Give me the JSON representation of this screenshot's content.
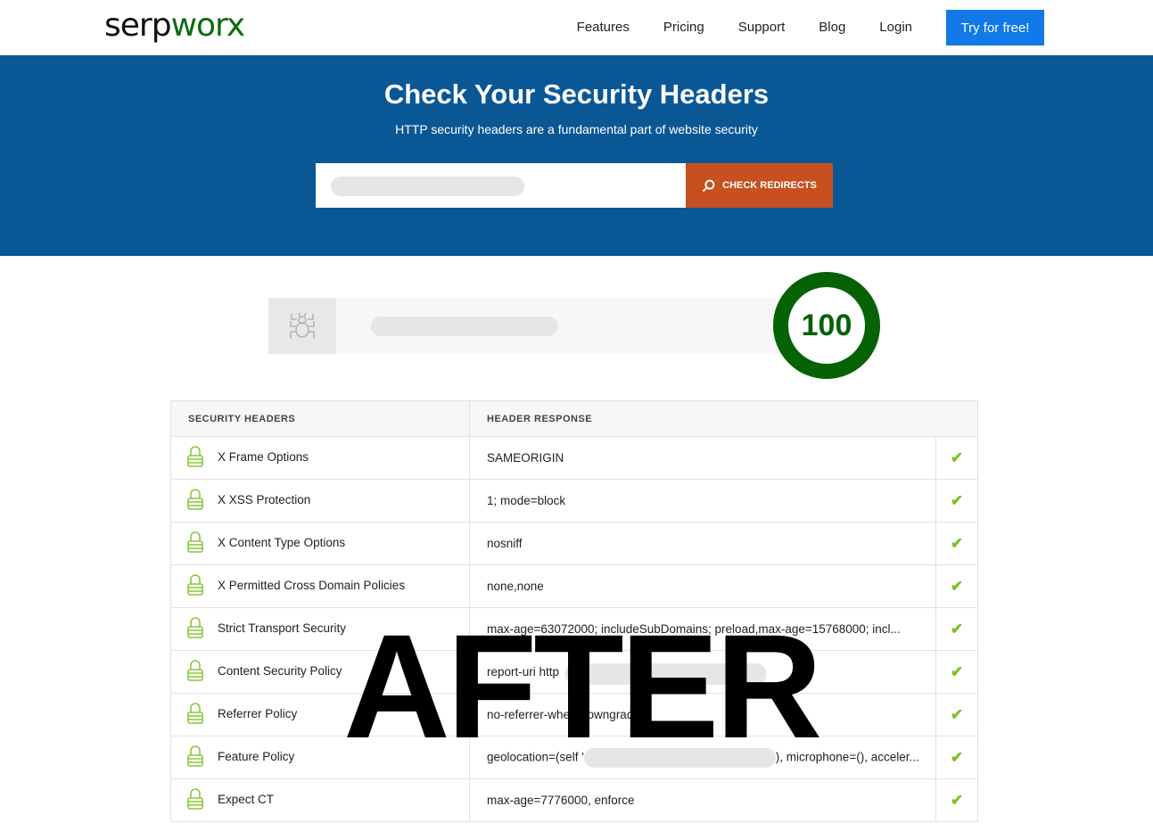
{
  "nav": {
    "logo_a": "serp",
    "logo_b": "worx",
    "links": [
      "Features",
      "Pricing",
      "Support",
      "Blog",
      "Login"
    ],
    "cta": "Try for free!"
  },
  "hero": {
    "title": "Check Your Security Headers",
    "subtitle": "HTTP security headers are a fundamental part of website security",
    "button": "CHECK REDIRECTS"
  },
  "score": "100",
  "table": {
    "headers": [
      "SECURITY HEADERS",
      "HEADER RESPONSE"
    ],
    "rows": [
      {
        "name": "X Frame Options",
        "value": "SAMEORIGIN"
      },
      {
        "name": "X XSS Protection",
        "value": "1; mode=block"
      },
      {
        "name": "X Content Type Options",
        "value": "nosniff"
      },
      {
        "name": "X Permitted Cross Domain Policies",
        "value": "none,none"
      },
      {
        "name": "Strict Transport Security",
        "value": "max-age=63072000; includeSubDomains; preload,max-age=15768000; incl..."
      },
      {
        "name": "Content Security Policy",
        "value": "report-uri http"
      },
      {
        "name": "Referrer Policy",
        "value": "no-referrer-when-downgrade"
      },
      {
        "name": "Feature Policy",
        "value": "geolocation=(self '",
        "value2": "), microphone=(), acceler..."
      },
      {
        "name": "Expect CT",
        "value": "max-age=7776000, enforce"
      }
    ]
  },
  "overlay": "AFTER",
  "colors": {
    "brand_green": "#0e6b0e",
    "hero_bg": "#0a5796",
    "cta": "#1179e8",
    "button": "#c6501f",
    "check": "#7cc21e"
  }
}
